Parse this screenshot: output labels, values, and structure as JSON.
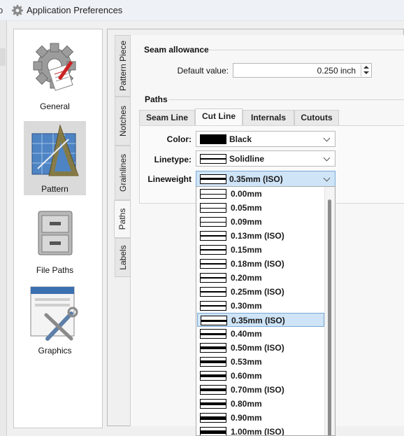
{
  "window": {
    "clipped_left_text": "o",
    "title": "Application Preferences"
  },
  "sidebar": {
    "items": [
      {
        "label": "General",
        "icon": "gear-icon",
        "selected": false
      },
      {
        "label": "Pattern",
        "icon": "pattern-drafting-icon",
        "selected": true
      },
      {
        "label": "File Paths",
        "icon": "file-cabinet-icon",
        "selected": false
      },
      {
        "label": "Graphics",
        "icon": "graphics-tools-icon",
        "selected": false
      }
    ]
  },
  "vertical_tabs": [
    "Pattern Piece",
    "Notches",
    "Grainlines",
    "Paths",
    "Labels"
  ],
  "active_vertical_tab": "Paths",
  "seam_allowance": {
    "title": "Seam allowance",
    "default_label": "Default value:",
    "default_value": "0.250 inch"
  },
  "paths": {
    "title": "Paths",
    "tabs": [
      "Seam Line",
      "Cut Line",
      "Internals",
      "Cutouts"
    ],
    "active_tab": "Cut Line",
    "color_label": "Color:",
    "color_value": "Black",
    "linetype_label": "Linetype:",
    "linetype_value": "Solidline",
    "lineweight_label": "Lineweight",
    "lineweight_value": "0.35mm (ISO)"
  },
  "lineweight_options": [
    {
      "label": "0.00mm",
      "thickness": 0.5
    },
    {
      "label": "0.05mm",
      "thickness": 1
    },
    {
      "label": "0.09mm",
      "thickness": 1
    },
    {
      "label": "0.13mm (ISO)",
      "thickness": 1.5
    },
    {
      "label": "0.15mm",
      "thickness": 1.5
    },
    {
      "label": "0.18mm (ISO)",
      "thickness": 2
    },
    {
      "label": "0.20mm",
      "thickness": 2
    },
    {
      "label": "0.25mm (ISO)",
      "thickness": 2.5
    },
    {
      "label": "0.30mm",
      "thickness": 2.5
    },
    {
      "label": "0.35mm (ISO)",
      "thickness": 3,
      "selected": true
    },
    {
      "label": "0.40mm",
      "thickness": 3
    },
    {
      "label": "0.50mm (ISO)",
      "thickness": 3.5
    },
    {
      "label": "0.53mm",
      "thickness": 3.5
    },
    {
      "label": "0.60mm",
      "thickness": 4
    },
    {
      "label": "0.70mm (ISO)",
      "thickness": 4
    },
    {
      "label": "0.80mm",
      "thickness": 4.5
    },
    {
      "label": "0.90mm",
      "thickness": 5
    },
    {
      "label": "1.00mm (ISO)",
      "thickness": 5
    }
  ],
  "colors": {
    "selection": "#cfe4f7",
    "selection_border": "#7aa8d6",
    "sidebar_selected": "#dadada"
  }
}
